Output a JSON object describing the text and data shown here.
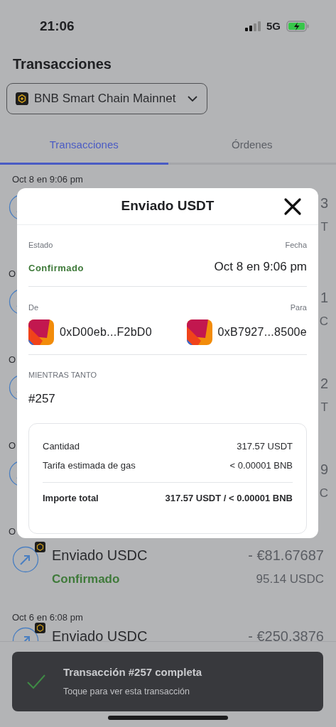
{
  "status_bar": {
    "time": "21:06",
    "network": "5G"
  },
  "title": "Transacciones",
  "network_selector": {
    "label": "BNB Smart Chain Mainnet"
  },
  "tabs": [
    {
      "label": "Transacciones",
      "selected": true
    },
    {
      "label": "Órdenes",
      "selected": false
    }
  ],
  "groups": [
    {
      "date": "Oct 8 en 9:06 pm",
      "fiat": "3",
      "crypto": "T"
    },
    {
      "date": "O",
      "fiat": "1",
      "crypto": "C"
    },
    {
      "date": "O",
      "fiat": "2",
      "crypto": "T"
    },
    {
      "date": "O",
      "fiat": "9",
      "crypto": "C"
    },
    {
      "date": "O",
      "title": "Enviado USDC",
      "status": "Confirmado",
      "fiat": "- €81.67687",
      "crypto": "95.14 USDC"
    },
    {
      "date": "Oct 6 en 6:08 pm",
      "title": "Enviado USDC",
      "fiat": "- €250.3876"
    }
  ],
  "modal": {
    "title": "Enviado USDT",
    "status_label": "Estado",
    "status": "Confirmado",
    "date_label": "Fecha",
    "date": "Oct 8 en 9:06 pm",
    "from_label": "De",
    "from": "0xD00eb...F2bD0",
    "to_label": "Para",
    "to": "0xB7927...8500e",
    "nonce_label": "MIENTRAS TANTO",
    "nonce": "#257",
    "summary": [
      {
        "kind": "line",
        "label": "Cantidad",
        "value": "317.57 USDT"
      },
      {
        "kind": "line",
        "label": "Tarifa estimada de gas",
        "value": "< 0.00001 BNB"
      },
      {
        "kind": "total",
        "label": "Importe total",
        "value": "317.57 USDT / < 0.00001 BNB"
      }
    ]
  },
  "toast": {
    "title": "Transacción #257 completa",
    "subtitle": "Toque para ver esta transacción"
  }
}
